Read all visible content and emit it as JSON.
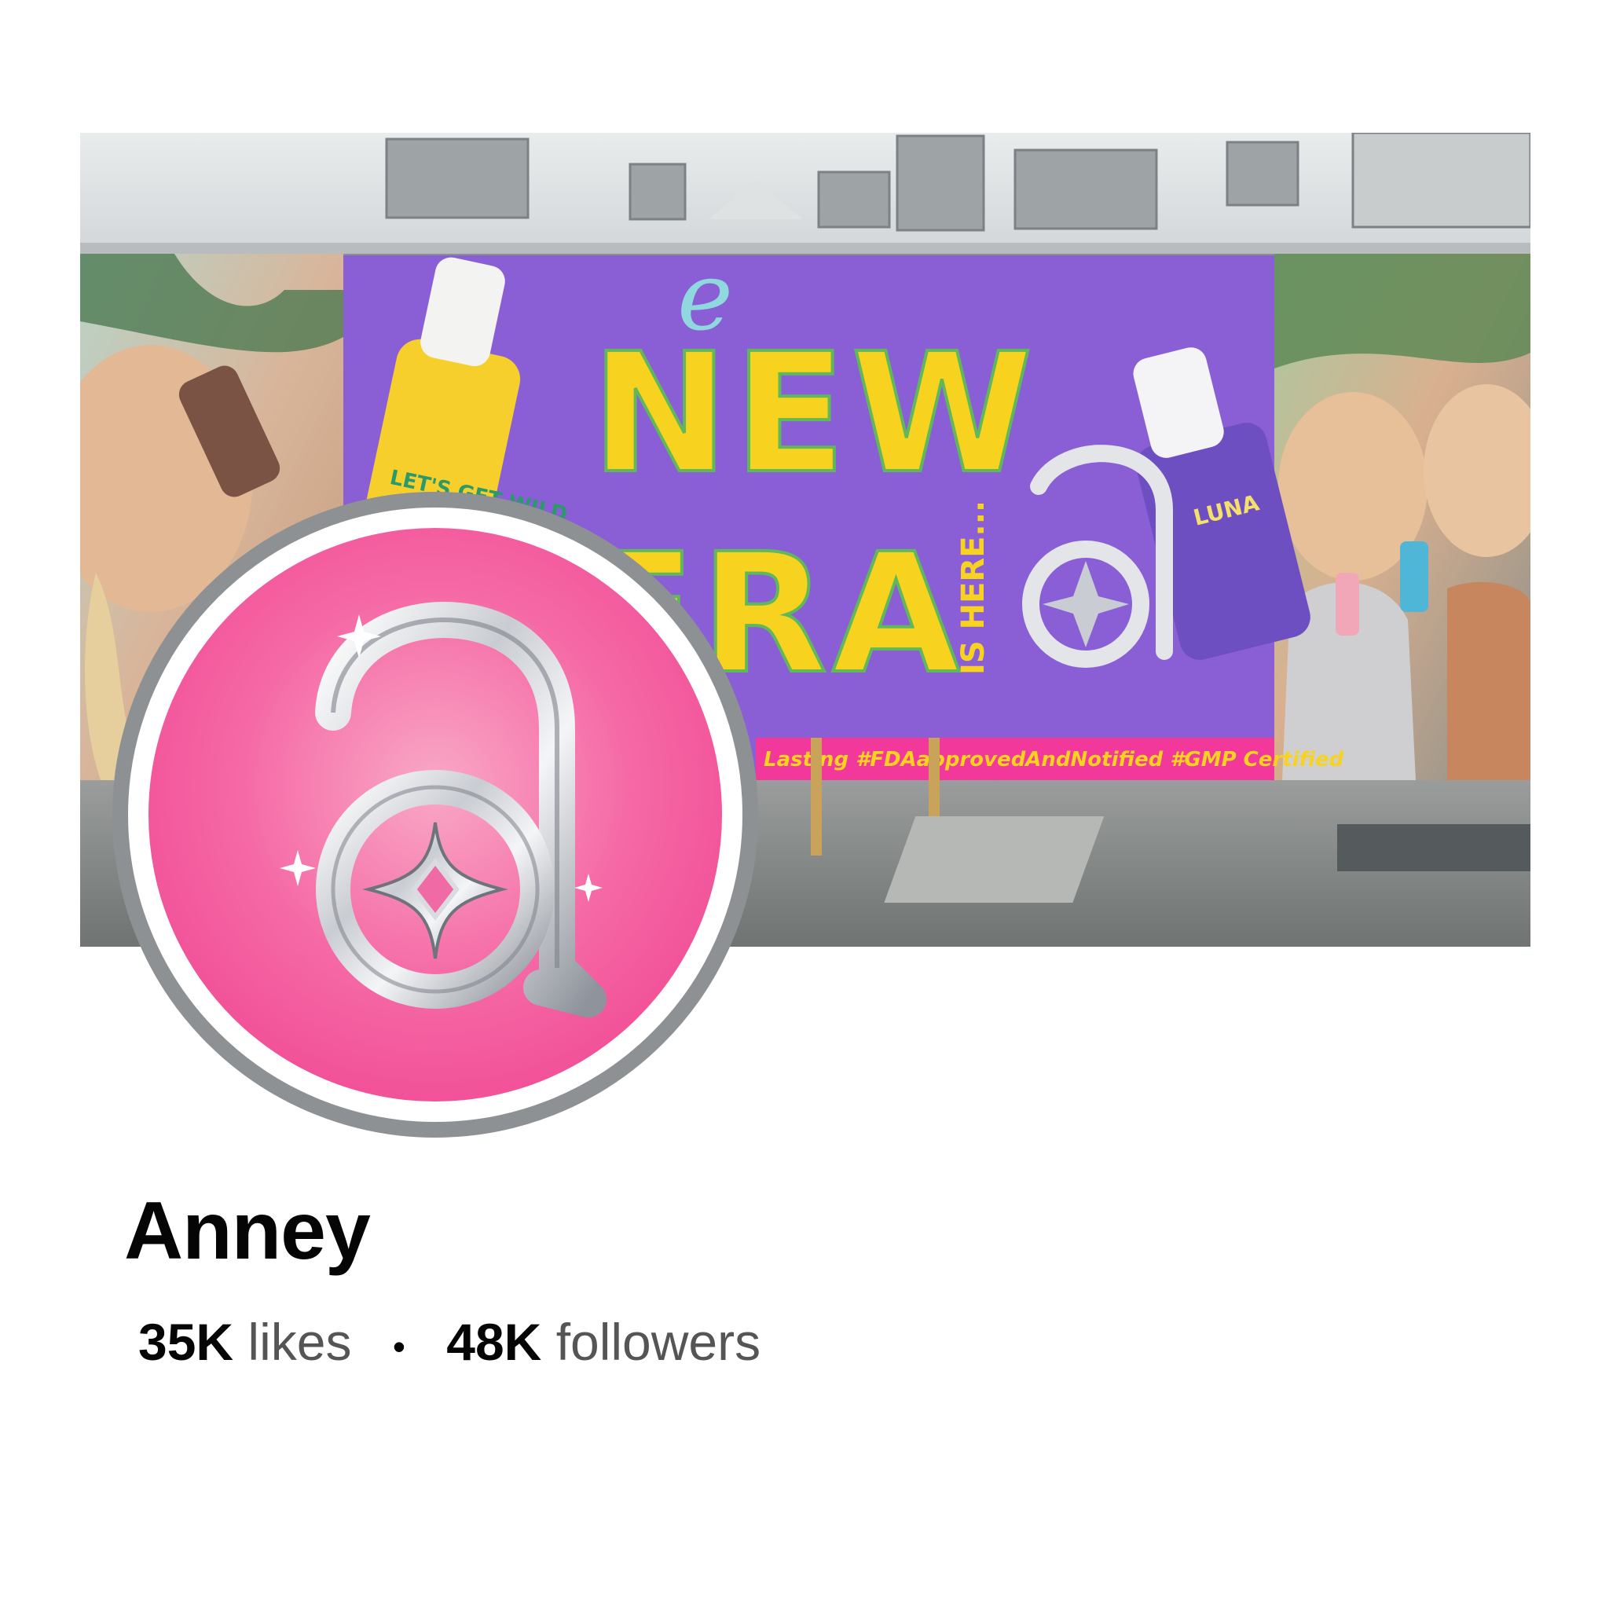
{
  "cover": {
    "banner_script": "e",
    "headline_line1": "NEW",
    "headline_line2": "ERA",
    "side_text": "IS HERE...",
    "left_bottle_label": "LET'S GET WILD",
    "right_bottle_label": "LUNA",
    "hashtag_strip": "Lasting #FDAapprovedAndNotified #GMP Certified"
  },
  "profile": {
    "avatar_icon": "anney-logo-icon",
    "name": "Anney",
    "likes_count": "35K",
    "likes_label": "likes",
    "separator": "•",
    "followers_count": "48K",
    "followers_label": "followers"
  },
  "colors": {
    "billboard_purple": "#8a5fd6",
    "headline_yellow": "#f7d21e",
    "hashtag_pink": "#f2389a",
    "avatar_pink": "#ef3b8c",
    "ring_gray": "#8e9193"
  }
}
